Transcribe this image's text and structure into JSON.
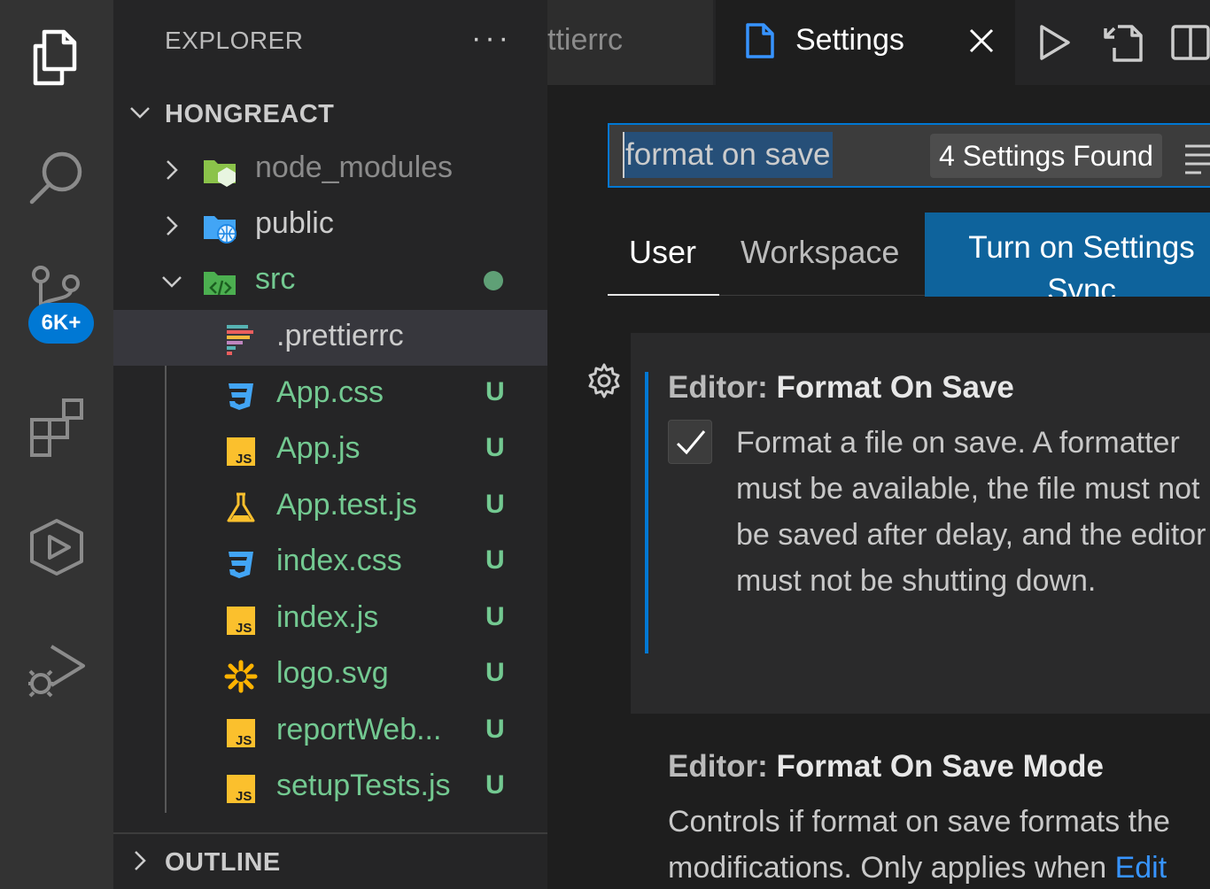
{
  "activity_bar": {
    "items": [
      {
        "name": "explorer-icon"
      },
      {
        "name": "search-icon"
      },
      {
        "name": "source-control-icon"
      },
      {
        "name": "extensions-icon"
      },
      {
        "name": "remote-explorer-icon"
      },
      {
        "name": "run-debug-icon"
      }
    ],
    "source_control_badge": "6K+"
  },
  "sidebar": {
    "title": "EXPLORER",
    "more_actions": "···",
    "project": "HONGREACT",
    "files": [
      {
        "label": "node_modules",
        "status": ""
      },
      {
        "label": "public",
        "status": ""
      },
      {
        "label": "src",
        "status": ""
      },
      {
        "label": ".prettierrc",
        "status": ""
      },
      {
        "label": "App.css",
        "status": "U"
      },
      {
        "label": "App.js",
        "status": "U"
      },
      {
        "label": "App.test.js",
        "status": "U"
      },
      {
        "label": "index.css",
        "status": "U"
      },
      {
        "label": "index.js",
        "status": "U"
      },
      {
        "label": "logo.svg",
        "status": "U"
      },
      {
        "label": "reportWeb...",
        "status": "U"
      },
      {
        "label": "setupTests.js",
        "status": "U"
      }
    ],
    "outline": "OUTLINE"
  },
  "tabs": {
    "inactive_label": "ttierrc",
    "active_label": "Settings"
  },
  "settings": {
    "search_value": "format on save",
    "found_count": "4 Settings Found",
    "scope_tabs": [
      "User",
      "Workspace"
    ],
    "sync_button": "Turn on Settings Sync",
    "items": [
      {
        "category": "Editor: ",
        "name": "Format On Save",
        "checked": true,
        "description": "Format a file on save. A formatter must be available, the file must not be saved after delay, and the editor must not be shutting down."
      },
      {
        "category": "Editor: ",
        "name": "Format On Save Mode",
        "description_line1": "Controls if format on save formats the",
        "description_line2_prefix": "modifications. Only applies when ",
        "description_link": "Edit"
      }
    ]
  },
  "colors": {
    "accent": "#0078d4",
    "untracked": "#73c991",
    "link": "#3794ff"
  }
}
